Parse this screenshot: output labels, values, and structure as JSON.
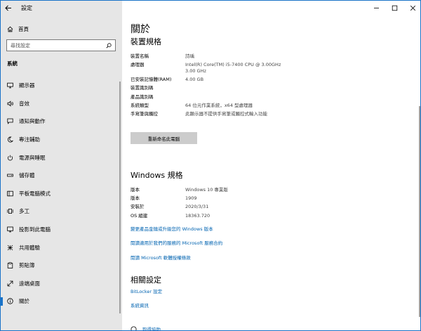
{
  "app_title": "設定",
  "sidebar": {
    "home_label": "首頁",
    "search_placeholder": "尋找設定",
    "section_title": "系統",
    "items": [
      {
        "label": "顯示器",
        "icon": "monitor-icon"
      },
      {
        "label": "音效",
        "icon": "speaker-icon"
      },
      {
        "label": "通知與動作",
        "icon": "message-icon"
      },
      {
        "label": "專注輔助",
        "icon": "moon-icon"
      },
      {
        "label": "電源與睡眠",
        "icon": "power-icon"
      },
      {
        "label": "儲存體",
        "icon": "storage-icon"
      },
      {
        "label": "平板電腦模式",
        "icon": "tablet-icon"
      },
      {
        "label": "多工",
        "icon": "multitask-icon"
      },
      {
        "label": "投影到此電腦",
        "icon": "projector-icon"
      },
      {
        "label": "共用體驗",
        "icon": "share-icon"
      },
      {
        "label": "剪貼簿",
        "icon": "clipboard-icon"
      },
      {
        "label": "遠端桌面",
        "icon": "remote-icon"
      },
      {
        "label": "關於",
        "icon": "info-icon",
        "active": true
      }
    ]
  },
  "main": {
    "page_title": "關於",
    "device_spec": {
      "title": "裝置規格",
      "rows": [
        {
          "k": "裝置名稱",
          "v": "詩瑀"
        },
        {
          "k": "處理器",
          "v": "Intel(R) Core(TM) i5-7400 CPU @ 3.00GHz   3.00 GHz"
        },
        {
          "k": "已安裝記憶體(RAM)",
          "v": "4.00 GB"
        },
        {
          "k": "裝置識別碼",
          "v": ""
        },
        {
          "k": "產品識別碼",
          "v": ""
        },
        {
          "k": "系統類型",
          "v": "64 位元作業系統，x64 型處理器"
        },
        {
          "k": "手寫筆與觸控",
          "v": "此顯示器不提供手寫筆或觸控式輸入功能"
        }
      ],
      "rename_button": "重新命名此電腦"
    },
    "windows_spec": {
      "title": "Windows 規格",
      "rows": [
        {
          "k": "版本",
          "v": "Windows 10 專業版"
        },
        {
          "k": "版本",
          "v": "1909"
        },
        {
          "k": "安裝於",
          "v": "2020/3/31"
        },
        {
          "k": "OS 組建",
          "v": "18363.720"
        }
      ],
      "link_change_key": "變更產品金鑰或升級您的 Windows 版本",
      "link_services": "閱讀適用於我們的服務的 Microsoft 服務合約",
      "link_license": "閱讀 Microsoft 軟體授權條款"
    },
    "related": {
      "title": "相關設定",
      "bitlocker": "BitLocker 設定",
      "system_info": "系統資訊"
    },
    "help": "取得協助"
  }
}
